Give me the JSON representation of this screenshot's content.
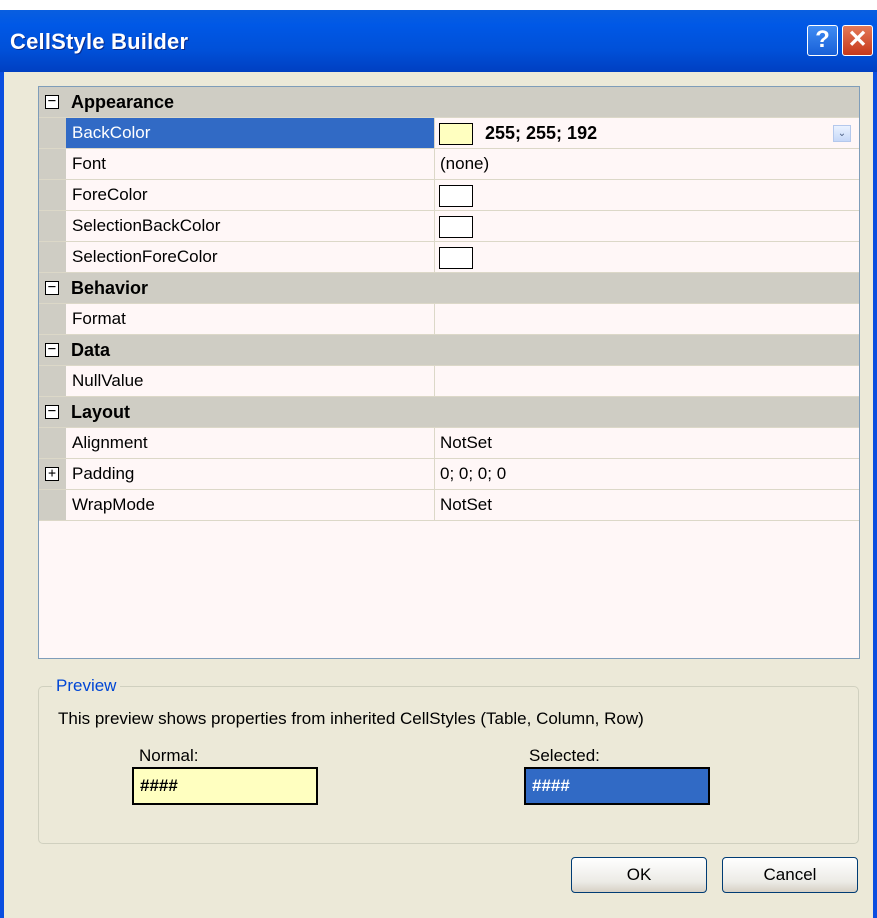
{
  "window": {
    "title": "CellStyle Builder",
    "help_glyph": "?",
    "close_glyph": "✕"
  },
  "grid": {
    "categories": [
      {
        "label": "Appearance",
        "toggle": "−"
      },
      {
        "label": "Behavior",
        "toggle": "−"
      },
      {
        "label": "Data",
        "toggle": "−"
      },
      {
        "label": "Layout",
        "toggle": "−"
      }
    ],
    "properties": {
      "backcolor": {
        "name": "BackColor",
        "value": "255; 255; 192",
        "swatch": "#ffffc0",
        "dropdown": "⌄"
      },
      "font": {
        "name": "Font",
        "value": "(none)"
      },
      "forecolor": {
        "name": "ForeColor",
        "swatch": "#ffffff"
      },
      "selectionbackcolor": {
        "name": "SelectionBackColor",
        "swatch": "#ffffff"
      },
      "selectionforecolor": {
        "name": "SelectionForeColor",
        "swatch": "#ffffff"
      },
      "format": {
        "name": "Format",
        "value": ""
      },
      "nullvalue": {
        "name": "NullValue",
        "value": ""
      },
      "alignment": {
        "name": "Alignment",
        "value": "NotSet"
      },
      "padding": {
        "name": "Padding",
        "value": "0; 0; 0; 0",
        "toggle": "+"
      },
      "wrapmode": {
        "name": "WrapMode",
        "value": "NotSet"
      }
    }
  },
  "preview": {
    "legend": "Preview",
    "info": "This preview shows properties from inherited CellStyles (Table, Column, Row)",
    "normal_label": "Normal:",
    "normal_text": "####",
    "normal_bg": "#ffffc0",
    "selected_label": "Selected:",
    "selected_text": "####",
    "selected_bg": "#316ac5"
  },
  "buttons": {
    "ok": "OK",
    "cancel": "Cancel"
  }
}
